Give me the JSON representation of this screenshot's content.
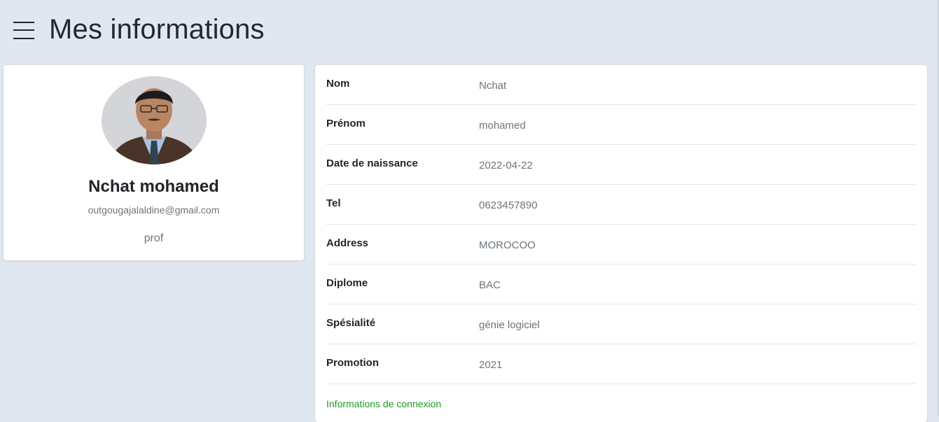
{
  "header": {
    "title": "Mes informations"
  },
  "profile": {
    "name": "Nchat mohamed",
    "email": "outgougajalaldine@gmail.com",
    "role": "prof"
  },
  "details": {
    "rows": [
      {
        "label": "Nom",
        "value": "Nchat"
      },
      {
        "label": "Prénom",
        "value": "mohamed"
      },
      {
        "label": "Date de naissance",
        "value": "2022-04-22"
      },
      {
        "label": "Tel",
        "value": "0623457890"
      },
      {
        "label": "Address",
        "value": "MOROCOO"
      },
      {
        "label": "Diplome",
        "value": "BAC"
      },
      {
        "label": "Spésialité",
        "value": "génie logiciel"
      },
      {
        "label": "Promotion",
        "value": "2021"
      }
    ],
    "connexion_link": "Informations de connexion"
  },
  "colors": {
    "background": "#e1e7f0",
    "card": "#ffffff",
    "link": "#1e9a26",
    "muted_text": "#6c757d"
  },
  "icons": {
    "menu": "hamburger-menu-icon"
  }
}
